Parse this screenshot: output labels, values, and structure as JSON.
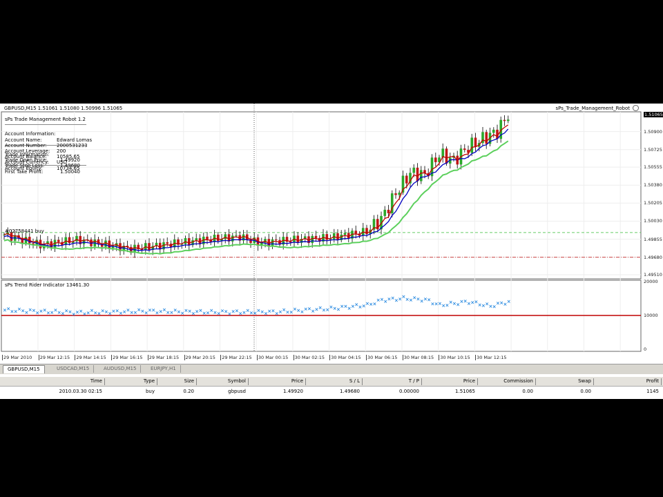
{
  "header": {
    "symbol_quote": "GBPUSD,M15  1.51061 1.51080 1.50996 1.51065",
    "ea_name": "sPs_Trade_Management_Robot"
  },
  "panel": {
    "title": "sPs Trade Management Robot 1.2",
    "account_heading": "Account Information:",
    "account": [
      [
        "Account Name:",
        "Edward Lomas"
      ],
      [
        "Account Number:",
        "2000531233"
      ],
      [
        "Account Leverage:",
        "200"
      ],
      [
        "Account Balance:",
        "10585.65"
      ],
      [
        "Account Currency:",
        "USD"
      ],
      [
        "Account Equity:",
        "10734.65"
      ]
    ],
    "trade_heading": "Trade Information:",
    "trade": [
      [
        "Trade Open Price:",
        "1.49920"
      ],
      [
        "Trade Stop Loss:",
        "1.49680"
      ],
      [
        "First Take Profit:",
        "1.50040"
      ]
    ]
  },
  "order_label": "#02758441 buy",
  "indicator_label": "sPs Trend Rider Indicator 13461.30",
  "price_axis": [
    "1.51065",
    "1.50900",
    "1.50725",
    "1.50555",
    "1.50380",
    "1.50205",
    "1.50030",
    "1.49855",
    "1.49680",
    "1.49510"
  ],
  "indicator_axis": [
    "20000",
    "10000",
    "0"
  ],
  "time_axis": [
    "29 Mar 2010",
    "29 Mar 12:15",
    "29 Mar 14:15",
    "29 Mar 16:15",
    "29 Mar 18:15",
    "29 Mar 20:15",
    "29 Mar 22:15",
    "30 Mar 00:15",
    "30 Mar 02:15",
    "30 Mar 04:15",
    "30 Mar 06:15",
    "30 Mar 08:15",
    "30 Mar 10:15",
    "30 Mar 12:15"
  ],
  "tabs": [
    "GBPUSD,M15",
    "USDCAD,M15",
    "AUDUSD,M15",
    "EURJPY,H1"
  ],
  "table": {
    "columns": [
      "Time",
      "Type",
      "Size",
      "Symbol",
      "Price",
      "S / L",
      "T / P",
      "Price",
      "Commission",
      "Swap",
      "Profit"
    ],
    "rows": [
      [
        "2010.03.30 02:15",
        "buy",
        "0.20",
        "gbpusd",
        "1.49920",
        "1.49680",
        "0.00000",
        "1.51065",
        "0.00",
        "0.00",
        "1145"
      ]
    ]
  },
  "chart_data": {
    "type": "candlestick",
    "price_range": [
      1.4951,
      1.51065
    ],
    "indicator_range": [
      0,
      20000
    ],
    "open_price": 1.4992,
    "stop_loss": 1.4968,
    "candle_count": 140,
    "close_keyframes": [
      [
        0,
        1.499
      ],
      [
        10,
        1.498
      ],
      [
        20,
        1.4985
      ],
      [
        35,
        1.4976
      ],
      [
        55,
        1.4985
      ],
      [
        65,
        1.4988
      ],
      [
        70,
        1.4982
      ],
      [
        80,
        1.4985
      ],
      [
        90,
        1.4987
      ],
      [
        100,
        1.4993
      ],
      [
        104,
        1.5005
      ],
      [
        108,
        1.503
      ],
      [
        112,
        1.505
      ],
      [
        116,
        1.5048
      ],
      [
        120,
        1.5068
      ],
      [
        124,
        1.5062
      ],
      [
        128,
        1.5075
      ],
      [
        132,
        1.5083
      ],
      [
        136,
        1.509
      ],
      [
        139,
        1.51065
      ]
    ],
    "indicator_keyframes": [
      [
        0,
        11500
      ],
      [
        20,
        10800
      ],
      [
        40,
        11200
      ],
      [
        60,
        10900
      ],
      [
        75,
        11000
      ],
      [
        90,
        12000
      ],
      [
        100,
        13000
      ],
      [
        104,
        14500
      ],
      [
        110,
        15000
      ],
      [
        116,
        14600
      ],
      [
        120,
        13000
      ],
      [
        128,
        14000
      ],
      [
        134,
        12700
      ],
      [
        139,
        14000
      ]
    ],
    "colors": {
      "bull": "#2aa82a",
      "bear": "#c01818",
      "ma_fast": "#c00000",
      "ma_mid": "#0000c0",
      "ma_slow": "#5cd05c",
      "indicator": "#2a8ae0",
      "level": "#c00000"
    }
  }
}
